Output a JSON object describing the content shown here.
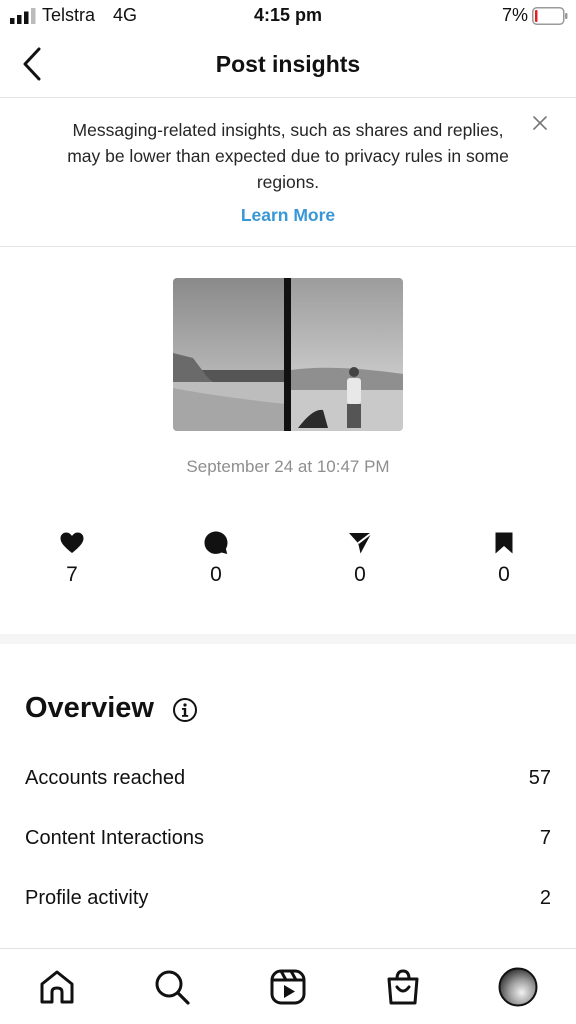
{
  "status_bar": {
    "carrier": "Telstra",
    "network": "4G",
    "time": "4:15 pm",
    "battery": "7%"
  },
  "header": {
    "title": "Post insights",
    "back_icon": "chevron-left-icon"
  },
  "notice": {
    "text": "Messaging-related insights, such as shares and replies, may be lower than expected due to privacy rules in some regions.",
    "link": "Learn More",
    "link_color": "#3897d6"
  },
  "post": {
    "date": "September 24 at 10:47 PM"
  },
  "stats": [
    {
      "icon": "heart-icon",
      "value": "7"
    },
    {
      "icon": "comment-icon",
      "value": "0"
    },
    {
      "icon": "share-icon",
      "value": "0"
    },
    {
      "icon": "bookmark-icon",
      "value": "0"
    }
  ],
  "overview": {
    "title": "Overview",
    "rows": [
      {
        "label": "Accounts reached",
        "value": "57"
      },
      {
        "label": "Content Interactions",
        "value": "7"
      },
      {
        "label": "Profile activity",
        "value": "2"
      }
    ]
  },
  "tab_bar": {
    "items": [
      "home-icon",
      "search-icon",
      "reels-icon",
      "shop-icon",
      "profile-avatar"
    ]
  }
}
